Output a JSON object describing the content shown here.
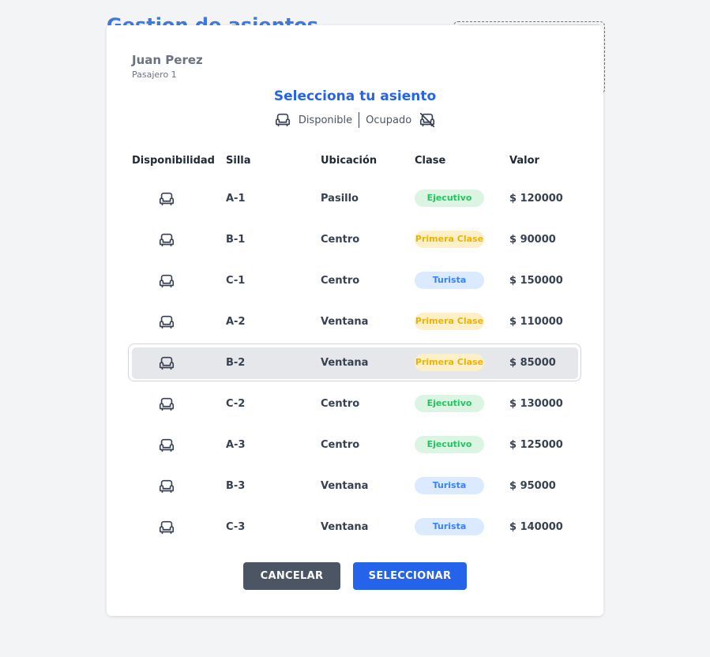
{
  "background": {
    "title": "Gestion de asientos"
  },
  "passenger": {
    "name": "Juan Perez",
    "label": "Pasajero 1"
  },
  "seat_picker": {
    "title": "Selecciona tu asiento",
    "legend": {
      "available": "Disponible",
      "occupied": "Ocupado"
    }
  },
  "table": {
    "headers": [
      "Disponibilidad",
      "Silla",
      "Ubicación",
      "Clase",
      "Valor"
    ],
    "rows": [
      {
        "seat": "A-1",
        "location": "Pasillo",
        "class": "Ejecutivo",
        "value": "$ 120000",
        "icon": "armchair-icon"
      },
      {
        "seat": "B-1",
        "location": "Centro",
        "class": "Primera Clase",
        "value": "$ 90000",
        "icon": "armchair-icon"
      },
      {
        "seat": "C-1",
        "location": "Centro",
        "class": "Turista",
        "value": "$ 150000",
        "icon": "armchair-icon"
      },
      {
        "seat": "A-2",
        "location": "Ventana",
        "class": "Primera Clase",
        "value": "$ 110000",
        "icon": "armchair-icon"
      },
      {
        "seat": "B-2",
        "location": "Ventana",
        "class": "Primera Clase",
        "value": "$ 85000",
        "icon": "armchair-icon",
        "selected": true
      },
      {
        "seat": "C-2",
        "location": "Centro",
        "class": "Ejecutivo",
        "value": "$ 130000",
        "icon": "armchair-icon"
      },
      {
        "seat": "A-3",
        "location": "Centro",
        "class": "Ejecutivo",
        "value": "$ 125000",
        "icon": "armchair-icon"
      },
      {
        "seat": "B-3",
        "location": "Ventana",
        "class": "Turista",
        "value": "$ 95000",
        "icon": "armchair-icon"
      },
      {
        "seat": "C-3",
        "location": "Ventana",
        "class": "Turista",
        "value": "$ 140000",
        "icon": "armchair-icon"
      }
    ]
  },
  "actions": {
    "cancel_label": "CANCELAR",
    "select_label": "SELECCIONAR"
  },
  "colors": {
    "primary": "#2563eb",
    "cancel": "#4b5563",
    "ejecutivo": "#22c55e",
    "primera_clase": "#eab308",
    "turista": "#3b82f6"
  }
}
